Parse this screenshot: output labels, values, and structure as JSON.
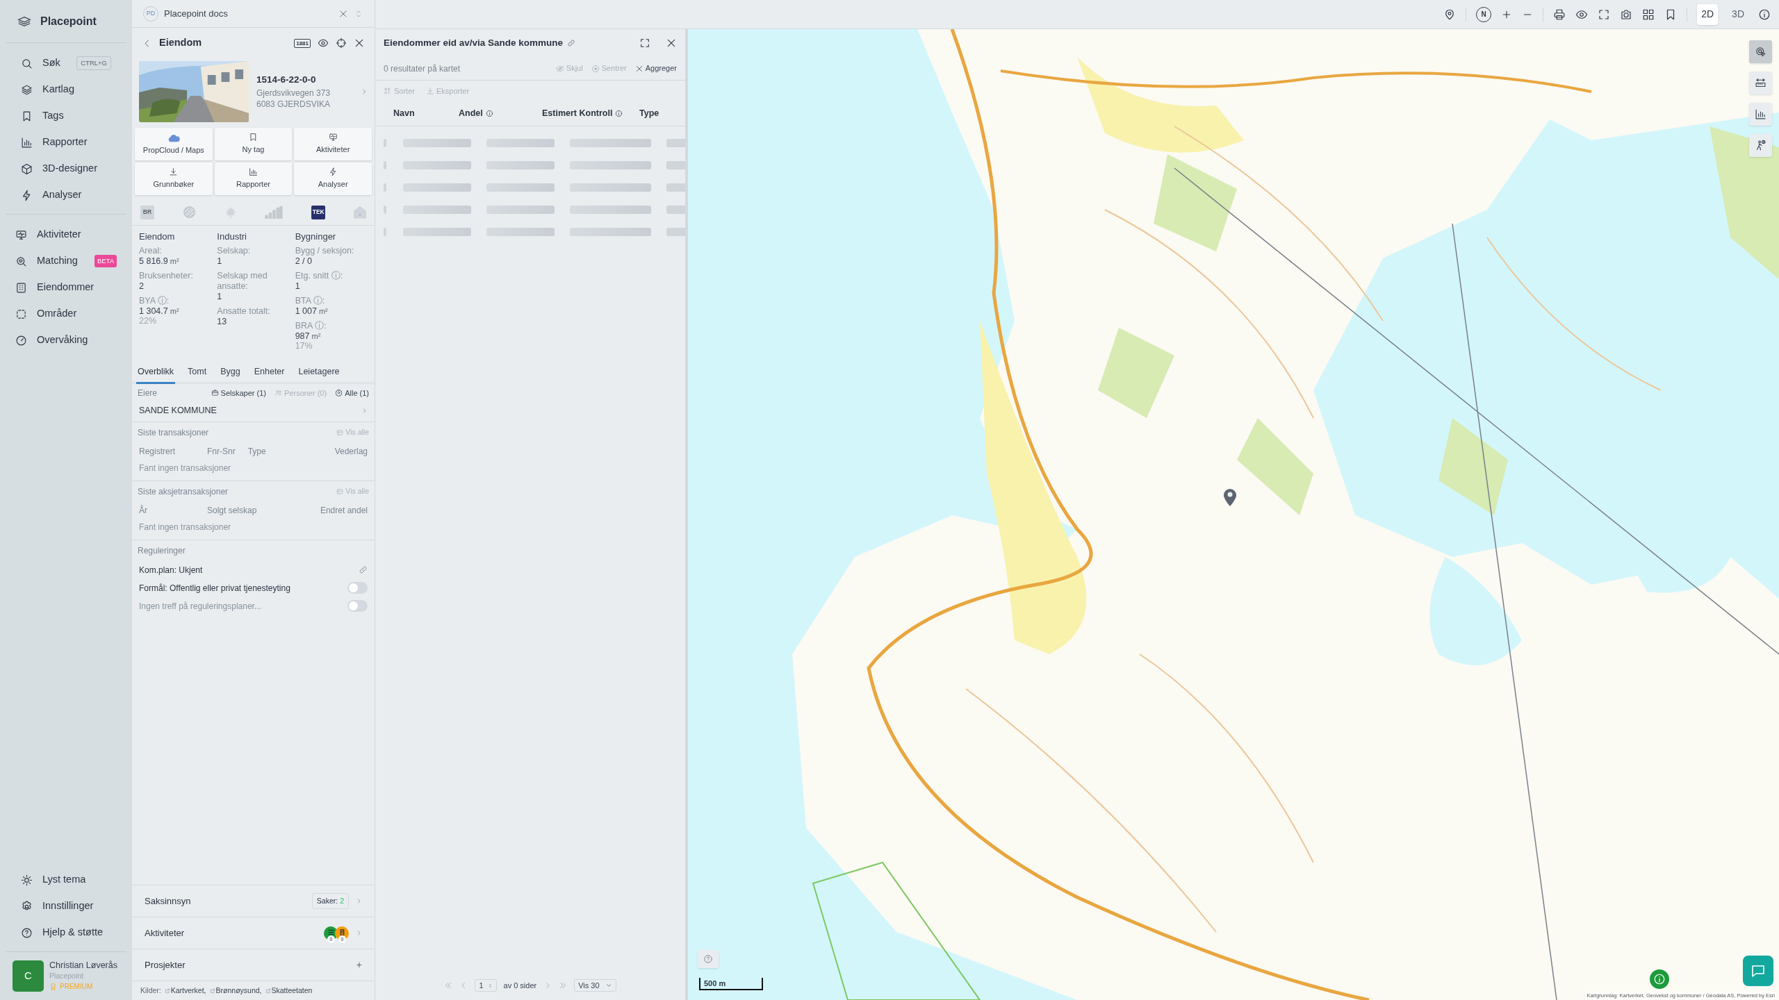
{
  "sidebar": {
    "brand": "Placepoint",
    "nav_main": [
      {
        "label": "Søk",
        "shortcut": "CTRL+G"
      },
      {
        "label": "Kartlag"
      },
      {
        "label": "Tags"
      },
      {
        "label": "Rapporter"
      },
      {
        "label": "3D-designer"
      },
      {
        "label": "Analyser"
      }
    ],
    "nav_tools": [
      {
        "label": "Aktiviteter"
      },
      {
        "label": "Matching",
        "badge": "BETA"
      },
      {
        "label": "Eiendommer"
      },
      {
        "label": "Områder"
      },
      {
        "label": "Overvåking"
      }
    ],
    "nav_footer": [
      {
        "label": "Lyst tema"
      },
      {
        "label": "Innstillinger"
      },
      {
        "label": "Hjelp & støtte"
      }
    ],
    "user": {
      "initial": "C",
      "name": "Christian Løverås",
      "org": "Placepoint",
      "plan": "PREMIUM"
    }
  },
  "docs_tab": {
    "badge": "PD",
    "title": "Placepoint docs"
  },
  "property_panel": {
    "title": "Eiendom",
    "badge": "1881",
    "id": "1514-6-22-0-0",
    "address": [
      "Gjerdsvikvegen 373",
      "6083 GJERDSVIKA"
    ],
    "actions": [
      "PropCloud / Maps",
      "Ny tag",
      "Aktiviteter",
      "Grunnbøker",
      "Rapporter",
      "Analyser"
    ],
    "sources": [
      {
        "kind": "text",
        "label": "BR",
        "active": false
      },
      {
        "kind": "hatch",
        "active": false
      },
      {
        "kind": "leaf",
        "active": false
      },
      {
        "kind": "bars",
        "active": false
      },
      {
        "kind": "text",
        "label": "TEK",
        "active": true
      },
      {
        "kind": "house",
        "label": "-",
        "active": false
      }
    ],
    "stats": [
      {
        "heading": "Eiendom",
        "fields": [
          {
            "label": "Areal:",
            "value": "5 816.9",
            "unit": "m²"
          },
          {
            "label": "Bruksenheter:",
            "value": "2"
          },
          {
            "label": "BYA ⓘ:",
            "value": "1 304.7",
            "unit": "m²",
            "share": "22%"
          }
        ]
      },
      {
        "heading": "Industri",
        "fields": [
          {
            "label": "Selskap:",
            "value": "1"
          },
          {
            "label": "Selskap med ansatte:",
            "value": "1"
          },
          {
            "label": "Ansatte totalt:",
            "value": "13"
          }
        ]
      },
      {
        "heading": "Bygninger",
        "fields": [
          {
            "label": "Bygg / seksjon:",
            "value": "2 / 0"
          },
          {
            "label": "Etg. snitt ⓘ:",
            "value": "1"
          },
          {
            "label": "BTA ⓘ:",
            "value": "1 007",
            "unit": "m²"
          },
          {
            "label": "BRA ⓘ:",
            "value": "987",
            "unit": "m²",
            "share": "17%"
          }
        ]
      }
    ],
    "tabs": [
      {
        "label": "Overblikk",
        "selected": true
      },
      {
        "label": "Tomt",
        "selected": false
      },
      {
        "label": "Bygg",
        "selected": false
      },
      {
        "label": "Enheter",
        "selected": false
      },
      {
        "label": "Leietagere",
        "selected": false
      }
    ],
    "owners": {
      "title": "Eiere",
      "filters": [
        {
          "label": "Selskaper (1)",
          "disabled": false
        },
        {
          "label": "Personer (0)",
          "disabled": true
        },
        {
          "label": "Alle (1)",
          "disabled": false
        }
      ],
      "entries": [
        "SANDE KOMMUNE"
      ]
    },
    "transactions": {
      "title": "Siste transaksjoner",
      "link": "Vis alle",
      "columns": [
        "Registrert",
        "Fnr-Snr",
        "Type",
        "Vederlag"
      ],
      "empty": "Fant ingen transaksjoner"
    },
    "share_transactions": {
      "title": "Siste aksjetransaksjoner",
      "link": "Vis alle",
      "columns": [
        "År",
        "Solgt selskap",
        "Endret andel"
      ],
      "empty": "Fant ingen transaksjoner"
    },
    "regulations": {
      "title": "Reguleringer",
      "rows": [
        {
          "kind": "link",
          "text": "Kom.plan: Ukjent"
        },
        {
          "kind": "toggle",
          "text": "Formål: Offentlig eller privat tjenesteyting",
          "on": false,
          "muted": false
        },
        {
          "kind": "toggle",
          "text": "Ingen treff på reguleringsplaner...",
          "on": false,
          "muted": true
        }
      ]
    },
    "sections": [
      {
        "kind": "cases",
        "label": "Saksinnsyn",
        "badge_label": "Saker:",
        "badge_value": "2"
      },
      {
        "kind": "activities",
        "label": "Aktiviteter",
        "counters": [
          {
            "color": "#1e9a3c",
            "count": "0"
          },
          {
            "color": "#f59e0b",
            "count": "0"
          }
        ]
      },
      {
        "kind": "projects",
        "label": "Prosjekter",
        "action": "+"
      }
    ],
    "sources_line": {
      "label": "Kilder:",
      "links": [
        "Kartverket,",
        "Brønnøysund,",
        "Skatteetaten"
      ]
    }
  },
  "results_panel": {
    "title": "Eiendommer eid av/via Sande kommune",
    "count_text": "0 resultater på kartet",
    "actions": [
      {
        "label": "Skjul",
        "disabled": true
      },
      {
        "label": "Sentrer",
        "disabled": true
      },
      {
        "label": "Aggreger",
        "disabled": false
      }
    ],
    "tools": [
      {
        "label": "Sorter",
        "disabled": true
      },
      {
        "label": "Eksporter",
        "disabled": true
      }
    ],
    "columns": [
      {
        "label": "Navn",
        "info": false
      },
      {
        "label": "Andel",
        "info": true
      },
      {
        "label": "Estimert Kontroll",
        "info": true
      },
      {
        "label": "Type",
        "info": false
      }
    ],
    "loading": true,
    "pagination": {
      "page": "1",
      "pages_text": "av 0 sider",
      "per_page": "Vis 30"
    }
  },
  "map": {
    "compass": "N",
    "view_modes": [
      {
        "label": "2D",
        "selected": true
      },
      {
        "label": "3D",
        "selected": false
      }
    ],
    "scale": "500 m",
    "attribution": "Kartgrunnlag: Kartverket, Geovekst og kommuner / Geodata AS, Powered by Esri"
  }
}
